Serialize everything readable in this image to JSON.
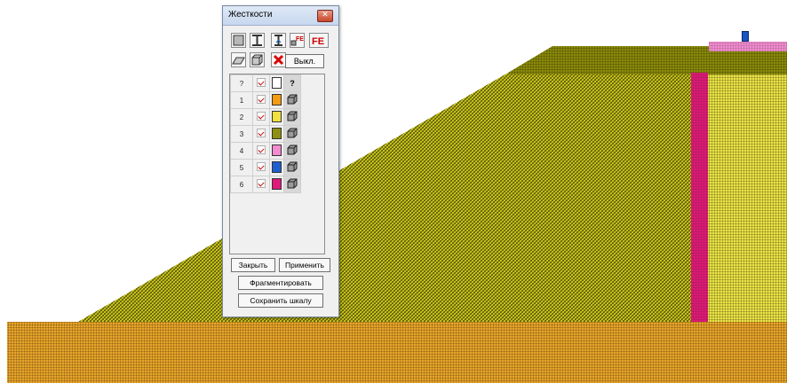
{
  "dialog": {
    "title": "Жесткости",
    "close_glyph": "✕",
    "toolbar": [
      {
        "name": "plate-stiffness-icon"
      },
      {
        "name": "beam-stiffness-icon"
      },
      {
        "name": "column-stiffness-icon"
      },
      {
        "name": "fe-small-icon",
        "text": "FE"
      },
      {
        "name": "fe-large-icon",
        "text": "FE"
      },
      {
        "name": "plane-icon"
      },
      {
        "name": "solid-icon"
      },
      {
        "name": "delete-icon"
      }
    ],
    "off_button": "Выкл.",
    "table": {
      "header": {
        "num": "?",
        "type": "?"
      },
      "rows": [
        {
          "num": "1",
          "color": "#f39c12"
        },
        {
          "num": "2",
          "color": "#f0e040"
        },
        {
          "num": "3",
          "color": "#8f8f12"
        },
        {
          "num": "4",
          "color": "#f48ad0"
        },
        {
          "num": "5",
          "color": "#1e5fd0"
        },
        {
          "num": "6",
          "color": "#e0197a"
        }
      ]
    },
    "buttons": {
      "close": "Закрыть",
      "apply": "Применить",
      "fragment": "Фрагментировать",
      "save_scale": "Сохранить шкалу"
    }
  },
  "materials": {
    "foundation": "#e8a52a",
    "embankment": "#c8c41a",
    "embankment_light": "#ece446",
    "top_layer": "#8a8a0a",
    "wall": "#e0197a",
    "pink": "#f08ad0"
  }
}
